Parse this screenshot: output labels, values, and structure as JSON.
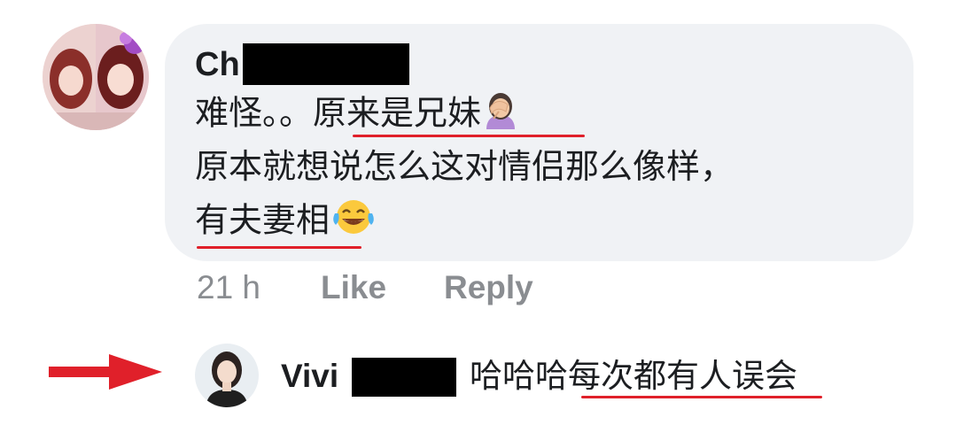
{
  "comment": {
    "author": "Ch",
    "line1_a": "难怪。。",
    "line1_b": "原来是兄妹",
    "line2": "原本就想说怎么这对情侣那么像样，",
    "line3": "有夫妻相",
    "emoji_facepalm": "face-palm-emoji",
    "emoji_laugh": "tears-of-joy-emoji"
  },
  "actions": {
    "time": "21 h",
    "like": "Like",
    "reply": "Reply"
  },
  "reply": {
    "author": "Vivi",
    "text": "哈哈哈每次都有人误会"
  },
  "colors": {
    "bubble": "#f0f2f5",
    "underline": "#e0202a",
    "arrow": "#e0202a",
    "meta": "#8a8d91"
  }
}
